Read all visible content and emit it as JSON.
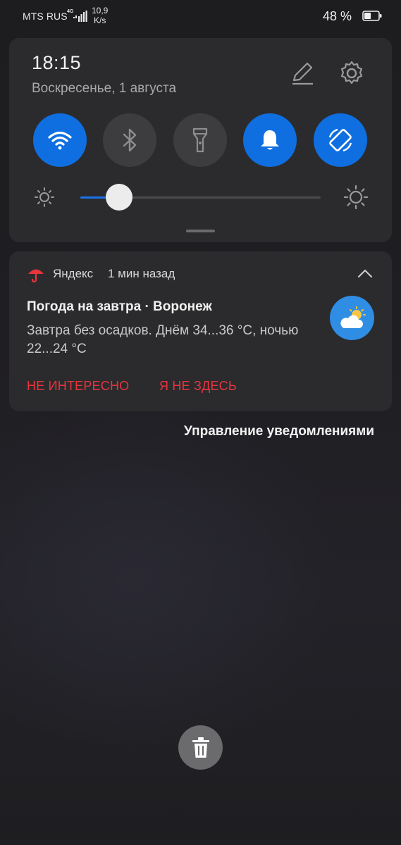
{
  "status_bar": {
    "carrier": "MTS RUS",
    "network_type": "4G",
    "speed_value": "10,9",
    "speed_unit": "K/s",
    "battery_percent": "48 %",
    "battery_level": 0.48
  },
  "quick_settings": {
    "time": "18:15",
    "date": "Воскресенье, 1 августа",
    "tiles": [
      {
        "name": "wifi",
        "icon": "wifi-icon",
        "enabled": true
      },
      {
        "name": "bluetooth",
        "icon": "bluetooth-icon",
        "enabled": false
      },
      {
        "name": "flashlight",
        "icon": "flashlight-icon",
        "enabled": false
      },
      {
        "name": "sound",
        "icon": "bell-icon",
        "enabled": true
      },
      {
        "name": "auto-rotate",
        "icon": "rotate-icon",
        "enabled": true
      }
    ],
    "brightness_level": 0.16,
    "accent_color": "#0f6fe0"
  },
  "notification": {
    "app_name": "Яндекс",
    "time_ago": "1 мин назад",
    "title": "Погода на завтра · Воронеж",
    "body": "Завтра без осадков. Днём 34...36 °C, ночью 22...24 °C",
    "icon": "partly-cloudy-icon",
    "actions": [
      {
        "label": "НЕ ИНТЕРЕСНО"
      },
      {
        "label": "Я НЕ ЗДЕСЬ"
      }
    ],
    "action_color": "#e8343d"
  },
  "manage_notifications_label": "Управление уведомлениями",
  "clear_all_icon": "trash-icon"
}
